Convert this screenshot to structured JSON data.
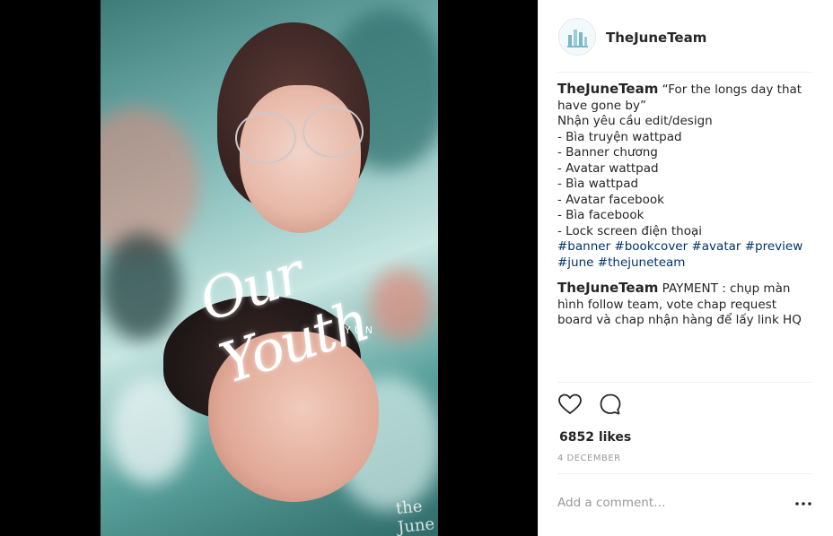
{
  "post": {
    "username": "TheJuneTeam",
    "media": {
      "title_script": "Our Youth",
      "artist": "YUN",
      "watermark": "the June"
    },
    "caption": {
      "username": "TheJuneTeam",
      "lines": [
        "“For the longs day that",
        "have gone by”",
        "Nhận yêu cầu edit/design",
        "- Bìa truyện wattpad",
        "- Banner chương",
        "- Avatar wattpad",
        "- Bìa wattpad",
        "- Avatar facebook",
        "- Bìa facebook",
        "- Lock screen điện thoại"
      ],
      "hashtags_line1": [
        "#banner",
        "#bookcover",
        "#avatar",
        "#preview"
      ],
      "hashtags_line2": [
        "#june",
        "#thejuneteam"
      ]
    },
    "comment": {
      "username": "TheJuneTeam",
      "text_lines": [
        "PAYMENT : chụp màn",
        "hình follow team, vote chap request",
        "board và chap nhận hàng để lấy link HQ"
      ]
    },
    "likes_text": "6852 likes",
    "date_text": "4 DECEMBER",
    "comment_placeholder": "Add a comment…",
    "icons": {
      "like": "heart-icon",
      "comment": "comment-bubble-icon",
      "more": "more-options-icon"
    },
    "colors": {
      "link": "#003569",
      "text": "#262626",
      "muted": "#999999",
      "divider": "#efefef"
    }
  }
}
